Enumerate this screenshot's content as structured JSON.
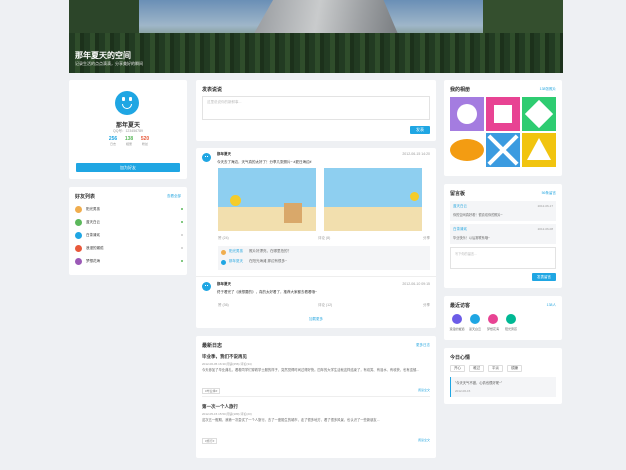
{
  "banner": {
    "title": "那年夏天的空间",
    "subtitle": "记录生活的点点滴滴，分享美好的瞬间"
  },
  "profile": {
    "name": "那年夏天",
    "qq": "QQ号：123456789",
    "stats": [
      {
        "num": "256",
        "label": "日志",
        "color": "#1fa6e3"
      },
      {
        "num": "138",
        "label": "相册",
        "color": "#5cb85c"
      },
      {
        "num": "520",
        "label": "粉丝",
        "color": "#e8593b"
      }
    ],
    "add_friend": "加为好友"
  },
  "friends": {
    "title": "好友列表",
    "link": "查看全部",
    "items": [
      {
        "name": "阳光男孩",
        "color": "#f0ad4e",
        "status": "#5cb85c"
      },
      {
        "name": "蓝天白云",
        "color": "#5cb85c",
        "status": "#5cb85c"
      },
      {
        "name": "白茶清欢",
        "color": "#1fa6e3",
        "status": "#ccc"
      },
      {
        "name": "浪漫的邂逅",
        "color": "#e8593b",
        "status": "#ccc"
      },
      {
        "name": "梦想花海",
        "color": "#9b59b6",
        "status": "#5cb85c"
      }
    ]
  },
  "publish": {
    "title": "发表说说",
    "placeholder": "这里说说你的新鲜事...",
    "button": "发表"
  },
  "posts": [
    {
      "author": "那年夏天",
      "time": "2012-06-15 14:20",
      "text": "今天去了海边，天气真的太好了！分享几张照片~ #夏日海边#",
      "likes": "赞 (24)",
      "comments": "评论 (8)",
      "share": "分享",
      "replies": [
        {
          "name": "阳光男孩",
          "text": "照片好漂亮，在哪里拍的？",
          "color": "#f0ad4e"
        },
        {
          "name": "那年夏天",
          "text": "在阳光海滩 那边有很多~",
          "color": "#1fa6e3"
        }
      ]
    },
    {
      "author": "那年夏天",
      "time": "2012-06-10 09:15",
      "text": "终于看完了《我想要的》，真的太好看了，推荐大家都去看看哦~",
      "likes": "赞 (36)",
      "comments": "评论 (12)",
      "share": "分享"
    }
  ],
  "more": "加载更多",
  "blog": {
    "title": "最新日志",
    "link": "更多日志",
    "items": [
      {
        "title": "毕业季，我们不说再见",
        "meta": "2012-06-05 16:30 阅读(256) 评论(34)",
        "text": "今天参加了毕业典礼，看着同学们穿着学士服的样子，突然觉得时间过得好快。四年的大学生活就这样结束了，有欢笑、有泪水、有收获，也有遗憾...",
        "tag": "#毕业季#",
        "read": "阅读全文"
      },
      {
        "title": "第一次一个人旅行",
        "meta": "2012-05-15 15:50 阅读(189) 评论(23)",
        "text": "这次五一假期，我第一次尝试了一个人旅行。去了一座陌生的城市，走了很多地方，看了很多风景，也认识了一些新朋友...",
        "tag": "#旅行#",
        "read": "阅读全文"
      }
    ]
  },
  "album": {
    "title": "我的相册",
    "link": "138张照片"
  },
  "messages": {
    "title": "留言板",
    "link": "56条留言",
    "items": [
      {
        "name": "蓝天白云",
        "date": "2012-06-17",
        "text": "你的空间真好看！很喜欢你的照片~"
      },
      {
        "name": "白茶清欢",
        "date": "2012-06-08",
        "text": "毕业快乐！以后常联系哦~"
      }
    ],
    "placeholder": "写下你的留言...",
    "button": "发表留言"
  },
  "visitors": {
    "title": "最近访客",
    "link": "138人",
    "items": [
      {
        "name": "浪漫的邂逅",
        "color": "#6c5ce7"
      },
      {
        "name": "蓝天白云",
        "color": "#1fa6e3"
      },
      {
        "name": "梦想花海",
        "color": "#e84393"
      },
      {
        "name": "阳光男孩",
        "color": "#00b894"
      }
    ]
  },
  "mood": {
    "title": "今日心情",
    "tags": [
      "开心",
      "难过",
      "平淡",
      "烦躁"
    ],
    "quote": "\"今天天气不错，心情也很好呢~\"",
    "date": "2012-06-15"
  },
  "colors": {
    "accent": "#1fa6e3"
  }
}
